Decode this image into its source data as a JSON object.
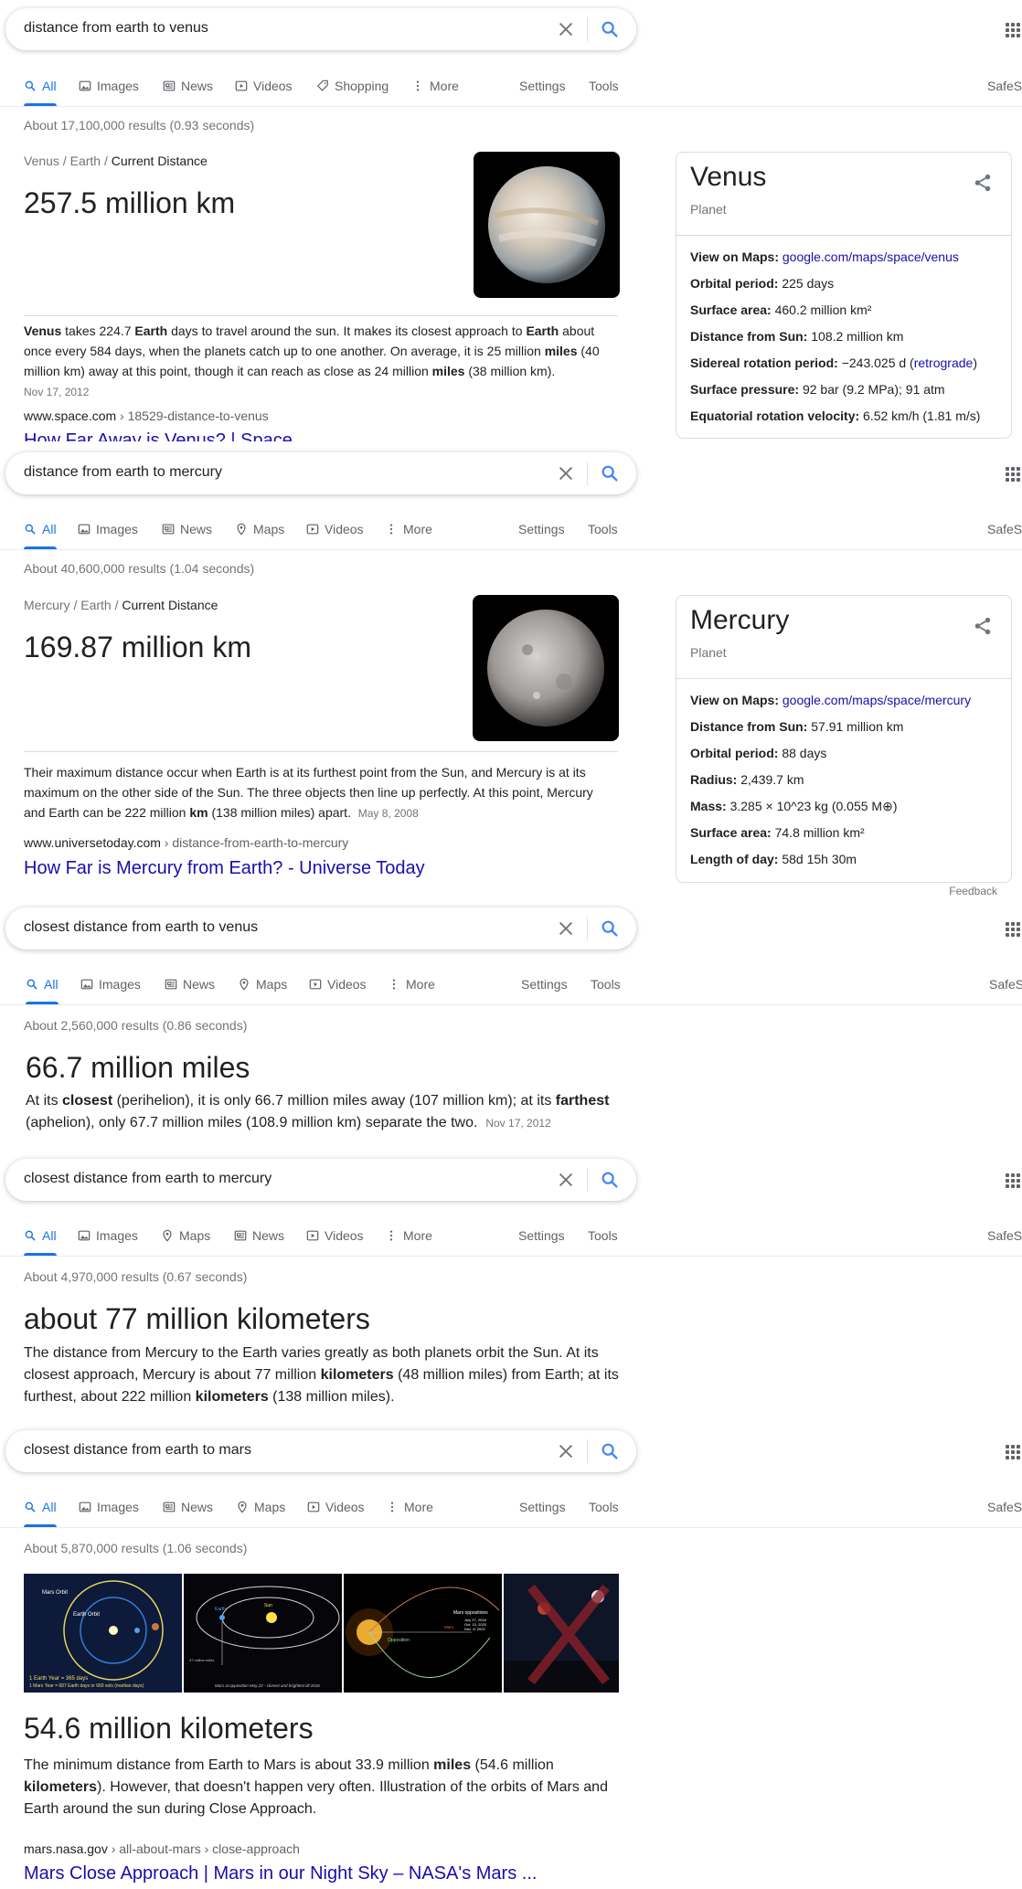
{
  "common": {
    "tab_settings": "Settings",
    "tab_tools": "Tools",
    "safesearch_label": "SafeS"
  },
  "s1": {
    "query": "distance from earth to venus",
    "tabs": [
      "All",
      "Images",
      "News",
      "Videos",
      "Shopping",
      "More"
    ],
    "stats": "About 17,100,000 results (0.93 seconds)",
    "crumb": [
      "Venus",
      "Earth",
      "Current Distance"
    ],
    "answer": "257.5 million km",
    "snippet": {
      "p1": "Venus",
      "p2": " takes 224.7 ",
      "p3": "Earth",
      "p4": " days to travel around the sun. It makes its closest approach to ",
      "p5": "Earth",
      "p6": " about once every 584 days, when the planets catch up to one another. On average, it is 25 million ",
      "p7": "miles",
      "p8": " (40 million km) away at this point, though it can reach as close as 24 million ",
      "p9": "miles",
      "p10": " (38 million km).",
      "date": "Nov 17, 2012"
    },
    "cite_domain": "www.space.com",
    "cite_path": " › 18529-distance-to-venus",
    "link": "How Far Away is Venus? | Space",
    "kp": {
      "title": "Venus",
      "subtitle": "Planet",
      "rows": [
        {
          "label": "View on Maps:",
          "value": "google.com/maps/space/venus"
        },
        {
          "label": "Orbital period:",
          "value": "225 days"
        },
        {
          "label": "Surface area:",
          "value": "460.2 million km²"
        },
        {
          "label": "Distance from Sun:",
          "value": "108.2 million km"
        },
        {
          "label": "Sidereal rotation period:",
          "value": "−243.025 d (",
          "extra": "retrograde",
          "tail": ")"
        },
        {
          "label": "Surface pressure:",
          "value": "92 bar (9.2 MPa); 91 atm"
        },
        {
          "label": "Equatorial rotation velocity:",
          "value": "6.52 km/h (1.81 m/s)"
        }
      ]
    }
  },
  "s2": {
    "query": "distance from earth to mercury",
    "tabs": [
      "All",
      "Images",
      "News",
      "Maps",
      "Videos",
      "More"
    ],
    "stats": "About 40,600,000 results (1.04 seconds)",
    "crumb": [
      "Mercury",
      "Earth",
      "Current Distance"
    ],
    "answer": "169.87 million km",
    "snippet": {
      "p1": "Their maximum distance occur when Earth is at its furthest point from the Sun, and Mercury is at its maximum on the other side of the Sun. The three objects then line up perfectly. At this point, Mercury and Earth can be 222 million ",
      "p2": "km",
      "p3": " (138 million miles) apart.",
      "date": "May 8, 2008"
    },
    "cite_domain": "www.universetoday.com",
    "cite_path": " › distance-from-earth-to-mercury",
    "link": "How Far is Mercury from Earth? - Universe Today",
    "kp": {
      "title": "Mercury",
      "subtitle": "Planet",
      "rows": [
        {
          "label": "View on Maps:",
          "value": "google.com/maps/space/mercury"
        },
        {
          "label": "Distance from Sun:",
          "value": "57.91 million km"
        },
        {
          "label": "Orbital period:",
          "value": "88 days"
        },
        {
          "label": "Radius:",
          "value": "2,439.7 km"
        },
        {
          "label": "Mass:",
          "value": "3.285 × 10^23 kg (0.055 M⊕)"
        },
        {
          "label": "Surface area:",
          "value": "74.8 million km²"
        },
        {
          "label": "Length of day:",
          "value": "58d 15h 30m"
        }
      ]
    },
    "feedback": "Feedback"
  },
  "s3": {
    "query": "closest distance from earth to venus",
    "tabs": [
      "All",
      "Images",
      "News",
      "Maps",
      "Videos",
      "More"
    ],
    "stats": "About 2,560,000 results (0.86 seconds)",
    "answer": "66.7 million miles",
    "snippet": {
      "p1": "At its ",
      "p2": "closest",
      "p3": " (perihelion), it is only 66.7 million miles away (107 million km); at its ",
      "p4": "farthest",
      "p5": " (aphelion), only 67.7 million miles (108.9 million km) separate the two.",
      "date": "Nov 17, 2012"
    }
  },
  "s4": {
    "query": "closest distance from earth to mercury",
    "tabs": [
      "All",
      "Images",
      "Maps",
      "News",
      "Videos",
      "More"
    ],
    "stats": "About 4,970,000 results (0.67 seconds)",
    "answer": "about 77 million kilometers",
    "snippet": {
      "p1": "The distance from Mercury to the Earth varies greatly as both planets orbit the Sun. At its closest approach, Mercury is about 77 million ",
      "p2": "kilometers",
      "p3": " (48 million miles) from Earth; at its furthest, about 222 million ",
      "p4": "kilometers",
      "p5": " (138 million miles)."
    }
  },
  "s5": {
    "query": "closest distance from earth to mars",
    "tabs": [
      "All",
      "Images",
      "News",
      "Maps",
      "Videos",
      "More"
    ],
    "stats": "About 5,870,000 results (1.06 seconds)",
    "thumb_texts": {
      "mars_orbit": "Mars Orbit",
      "earth_orbit": "Earth Orbit",
      "earth_year": "1 Earth Year = 365 days",
      "mars_year": "1 Mars Year = 687 Earth days or 669 sols (martian days)",
      "earth": "Earth",
      "sun": "Sun",
      "miles": "47 million miles",
      "caption": "Mars at opposition May 22 - closest and brightest till 2016",
      "opposition": "Opposition",
      "mars_opp_title": "Mars oppositions",
      "mars_opp_1": "July 27, 2018",
      "mars_opp_2": "Oct. 13, 2020",
      "mars_opp_3": "Dec. 8, 2022",
      "mars": "Mars"
    },
    "answer": "54.6 million kilometers",
    "snippet": {
      "p1": "The minimum distance from Earth to Mars is about 33.9 million ",
      "p2": "miles",
      "p3": " (54.6 million ",
      "p4": "kilometers",
      "p5": "). However, that doesn't happen very often. Illustration of the orbits of Mars and Earth around the sun during Close Approach."
    },
    "cite_domain": "mars.nasa.gov",
    "cite_path": " › all-about-mars › close-approach",
    "link": "Mars Close Approach | Mars in our Night Sky – NASA's Mars ..."
  }
}
